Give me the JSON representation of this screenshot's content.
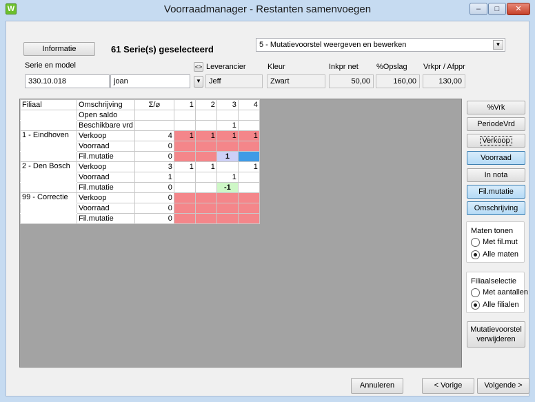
{
  "window": {
    "title": "Voorraadmanager - Restanten samenvoegen",
    "app_letter": "W"
  },
  "controls": {
    "minimize": "–",
    "maximize": "□",
    "close": "✕"
  },
  "header": {
    "info_button": "Informatie",
    "selection": "61 Serie(s) geselecteerd",
    "mode_selected": "5 - Mutatievoorstel weergeven en bewerken"
  },
  "fields": {
    "serie_label": "Serie en model",
    "serie_value": "330.10.018",
    "model_value": "joan",
    "swap_button": "<>",
    "leverancier_label": "Leverancier",
    "leverancier_value": "Jeff",
    "kleur_label": "Kleur",
    "kleur_value": "Zwart",
    "inkpr_label": "Inkpr net",
    "inkpr_value": "50,00",
    "opslag_label": "%Opslag",
    "opslag_value": "160,00",
    "vrkpr_label": "Vrkpr / Afppr",
    "vrkpr_value": "130,00"
  },
  "grid": {
    "headers": [
      "Filiaal",
      "Omschrijving",
      "Σ/⌀",
      "1",
      "2",
      "3",
      "4"
    ],
    "rows": [
      {
        "filiaal": "",
        "omschr": "Open saldo",
        "sum": "",
        "c": [
          "",
          "",
          "",
          ""
        ],
        "s": [
          "",
          "",
          "",
          ""
        ]
      },
      {
        "filiaal": "",
        "omschr": "Beschikbare vrd",
        "sum": "",
        "c": [
          "",
          "",
          "1",
          ""
        ],
        "s": [
          "",
          "",
          "",
          ""
        ]
      },
      {
        "filiaal": "1 - Eindhoven",
        "omschr": "Verkoop",
        "sum": "4",
        "c": [
          "1",
          "1",
          "1",
          "1"
        ],
        "s": [
          "red",
          "red",
          "red",
          "red"
        ]
      },
      {
        "filiaal": "",
        "omschr": "Voorraad",
        "sum": "0",
        "c": [
          "",
          "",
          "",
          ""
        ],
        "s": [
          "red",
          "red",
          "red",
          "red"
        ]
      },
      {
        "filiaal": "",
        "omschr": "Fil.mutatie",
        "sum": "0",
        "c": [
          "",
          "",
          "1",
          ""
        ],
        "s": [
          "red",
          "red",
          "lav",
          "blu"
        ]
      },
      {
        "filiaal": "2 - Den Bosch",
        "omschr": "Verkoop",
        "sum": "3",
        "c": [
          "1",
          "1",
          "",
          "1"
        ],
        "s": [
          "",
          "",
          "",
          ""
        ]
      },
      {
        "filiaal": "",
        "omschr": "Voorraad",
        "sum": "1",
        "c": [
          "",
          "",
          "1",
          ""
        ],
        "s": [
          "",
          "",
          "",
          ""
        ]
      },
      {
        "filiaal": "",
        "omschr": "Fil.mutatie",
        "sum": "0",
        "c": [
          "",
          "",
          "-1",
          ""
        ],
        "s": [
          "",
          "",
          "grn",
          ""
        ]
      },
      {
        "filiaal": "99 - Correctie",
        "omschr": "Verkoop",
        "sum": "0",
        "c": [
          "",
          "",
          "",
          ""
        ],
        "s": [
          "red",
          "red",
          "red",
          "red"
        ]
      },
      {
        "filiaal": "",
        "omschr": "Voorraad",
        "sum": "0",
        "c": [
          "",
          "",
          "",
          ""
        ],
        "s": [
          "red",
          "red",
          "red",
          "red"
        ]
      },
      {
        "filiaal": "",
        "omschr": "Fil.mutatie",
        "sum": "0",
        "c": [
          "",
          "",
          "",
          ""
        ],
        "s": [
          "red",
          "red",
          "red",
          "red"
        ]
      }
    ]
  },
  "side_buttons": [
    "%Vrk",
    "PeriodeVrd",
    "Verkoop",
    "Voorraad",
    "In nota",
    "Fil.mutatie",
    "Omschrijving"
  ],
  "maten": {
    "title": "Maten tonen",
    "options": [
      "Met fil.mut",
      "Alle maten"
    ],
    "selected": 1
  },
  "filiaal": {
    "title": "Filiaalselectie",
    "options": [
      "Met aantallen",
      "Alle filialen"
    ],
    "selected": 1
  },
  "mutatie_button": {
    "line1": "Mutatievoorstel",
    "line2": "verwijderen"
  },
  "footer": {
    "cancel": "Annuleren",
    "prev": "< Vorige",
    "next": "Volgende >"
  },
  "colors": {
    "red": "#f4868a",
    "lavender": "#cdd0f7",
    "blue": "#3f9be6",
    "green": "#cef7c6",
    "toggle_on": "#b6dbf6"
  }
}
